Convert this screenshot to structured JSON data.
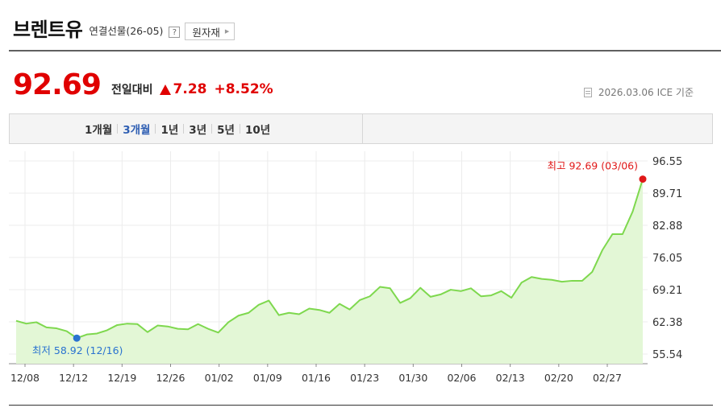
{
  "header": {
    "title": "브렌트유",
    "subtitle": "연결선물(26-05)",
    "help_label": "?",
    "raw_button_label": "원자재"
  },
  "quote": {
    "price": "92.69",
    "change_label": "전일대비",
    "change_value": "7.28",
    "change_percent": "+8.52%",
    "as_of_date": "2026.03.06",
    "as_of_source": "ICE 기준",
    "up_color": "#e00000"
  },
  "periods": [
    {
      "label": "1개월",
      "active": false
    },
    {
      "label": "3개월",
      "active": true
    },
    {
      "label": "1년",
      "active": false
    },
    {
      "label": "3년",
      "active": false
    },
    {
      "label": "5년",
      "active": false
    },
    {
      "label": "10년",
      "active": false
    }
  ],
  "chart_data": {
    "type": "area",
    "x_ticks": [
      "12/08",
      "12/12",
      "12/19",
      "12/26",
      "01/02",
      "01/09",
      "01/16",
      "01/23",
      "01/30",
      "02/06",
      "02/13",
      "02/20",
      "02/27"
    ],
    "y_ticks": [
      "96.55",
      "89.71",
      "82.88",
      "76.05",
      "69.21",
      "62.38",
      "55.54"
    ],
    "ylim": [
      55.54,
      96.55
    ],
    "values": [
      62.6,
      62.0,
      62.3,
      61.2,
      61.0,
      60.4,
      58.92,
      59.7,
      59.9,
      60.6,
      61.7,
      62.0,
      61.9,
      60.2,
      61.6,
      61.4,
      60.9,
      60.8,
      61.9,
      60.9,
      60.1,
      62.3,
      63.7,
      64.3,
      66.0,
      66.9,
      63.8,
      64.3,
      64.0,
      65.2,
      64.9,
      64.3,
      66.2,
      65.0,
      67.0,
      67.8,
      69.8,
      69.5,
      66.4,
      67.4,
      69.6,
      67.7,
      68.2,
      69.2,
      68.9,
      69.5,
      67.8,
      68.0,
      68.9,
      67.5,
      70.7,
      71.9,
      71.5,
      71.3,
      70.9,
      71.1,
      71.1,
      73.0,
      77.6,
      81.0,
      81.0,
      85.8,
      92.69
    ],
    "high_label": "최고 92.69 (03/06)",
    "low_label": "최저 58.92 (12/16)",
    "high_color": "#e01818",
    "low_color": "#2a73d0",
    "line_color": "#7ed84e",
    "fill_color": "#e3f7d6",
    "grid": true
  }
}
